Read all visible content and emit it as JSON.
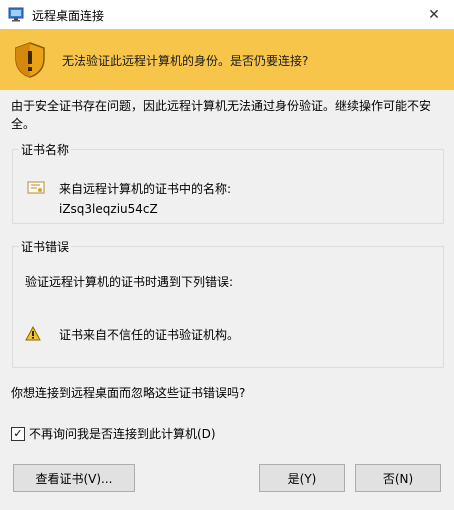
{
  "window": {
    "title": "远程桌面连接",
    "close_glyph": "✕"
  },
  "banner": {
    "message": "无法验证此远程计算机的身份。是否仍要连接?"
  },
  "intro": "由于安全证书存在问题，因此远程计算机无法通过身份验证。继续操作可能不安全。",
  "cert_name_group": {
    "legend": "证书名称",
    "label": "来自远程计算机的证书中的名称:",
    "value": "iZsq3leqziu54cZ"
  },
  "cert_errors_group": {
    "legend": "证书错误",
    "label": "验证远程计算机的证书时遇到下列错误:",
    "error": "证书来自不信任的证书验证机构。"
  },
  "question": "你想连接到远程桌面而忽略这些证书错误吗?",
  "dont_ask": {
    "label": "不再询问我是否连接到此计算机(D)",
    "checked": true,
    "check_glyph": "✓"
  },
  "buttons": {
    "view_cert": "查看证书(V)...",
    "yes": "是(Y)",
    "no": "否(N)"
  },
  "colors": {
    "banner": "#f7c54a",
    "titlebar": "#ffffff",
    "background": "#f0f0f0"
  },
  "icons": [
    "remote-desktop-icon",
    "shield-warning-icon",
    "certificate-icon",
    "warning-icon",
    "close-icon"
  ]
}
